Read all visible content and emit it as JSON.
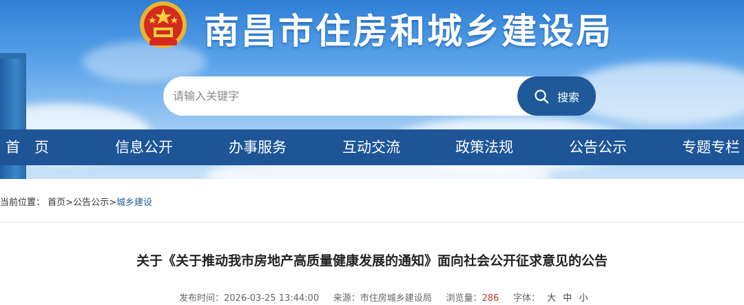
{
  "header": {
    "site_title": "南昌市住房和城乡建设局",
    "emblem_icon": "national-emblem-icon"
  },
  "search": {
    "placeholder": "请输入关键字",
    "button_label": "搜索",
    "icon": "search-icon"
  },
  "nav": {
    "items": [
      {
        "label": "首　页"
      },
      {
        "label": "信息公开"
      },
      {
        "label": "办事服务"
      },
      {
        "label": "互动交流"
      },
      {
        "label": "政策法规"
      },
      {
        "label": "公告公示"
      },
      {
        "label": "专题专栏"
      }
    ]
  },
  "breadcrumb": {
    "prefix": "当前位置：",
    "home": "首页",
    "sep1": ">",
    "section": "公告公示",
    "sep2": ">",
    "current": "城乡建设"
  },
  "article": {
    "title": "关于《关于推动我市房地产高质量健康发展的通知》面向社会公开征求意见的公告",
    "publish_label": "发布时间：",
    "publish_time": "2026-03-25 13:44:00",
    "source_label": "来源：",
    "source": "市住房城乡建设局",
    "views_label": "浏览量：",
    "views": "286",
    "font_label": "字体：",
    "font_large": "大",
    "font_medium": "中",
    "font_small": "小"
  },
  "colors": {
    "nav_bg": "#1d5597",
    "search_button": "#1e5a99",
    "views_number": "#c0392b"
  }
}
